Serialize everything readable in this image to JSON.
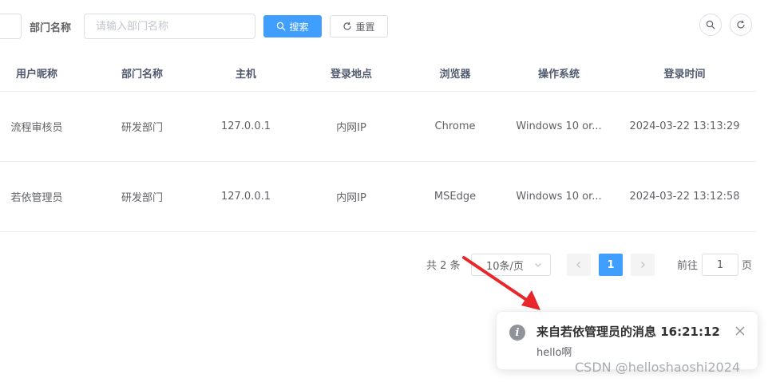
{
  "search": {
    "dept_label": "部门名称",
    "dept_placeholder": "请输入部门名称",
    "search_label": "搜索",
    "reset_label": "重置"
  },
  "table": {
    "headers": [
      "用户昵称",
      "部门名称",
      "主机",
      "登录地点",
      "浏览器",
      "操作系统",
      "登录时间"
    ],
    "rows": [
      [
        "流程审核员",
        "研发部门",
        "127.0.0.1",
        "内网IP",
        "Chrome",
        "Windows 10 or...",
        "2024-03-22 13:13:29"
      ],
      [
        "若依管理员",
        "研发部门",
        "127.0.0.1",
        "内网IP",
        "MSEdge",
        "Windows 10 or...",
        "2024-03-22 13:12:58"
      ]
    ]
  },
  "pagination": {
    "total": "共 2 条",
    "page_size": "10条/页",
    "current": "1",
    "goto_label": "前往",
    "goto_value": "1",
    "goto_unit": "页"
  },
  "notification": {
    "title": "来自若依管理员的消息 16:21:12",
    "message": "hello啊"
  },
  "watermark": "CSDN @helloshaoshi2024",
  "colors": {
    "primary": "#409eff",
    "annotation_arrow": "#e8262b"
  },
  "icons": [
    "search-icon",
    "refresh-icon",
    "chevron-down-icon",
    "chevron-left-icon",
    "chevron-right-icon",
    "info-icon",
    "close-icon"
  ]
}
